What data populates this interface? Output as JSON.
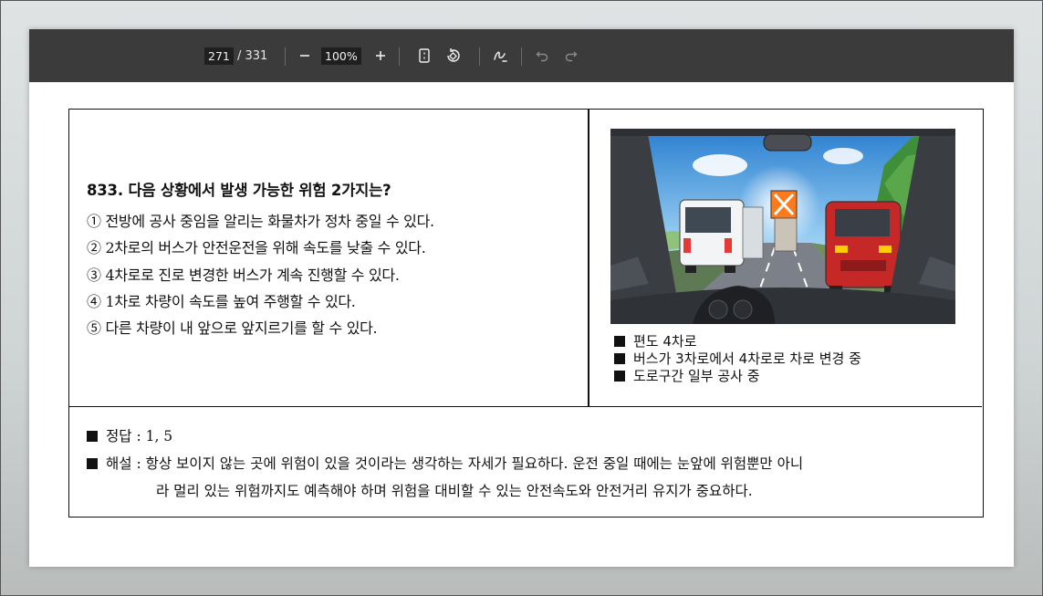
{
  "toolbar": {
    "page_current": "271",
    "page_total": "/ 331",
    "zoom": "100%",
    "icons": [
      "minus-icon",
      "plus-icon",
      "fit-page-icon",
      "rotate-icon",
      "draw-icon",
      "undo-icon",
      "redo-icon"
    ]
  },
  "question": {
    "title": "833. 다음 상황에서 발생 가능한 위험 2가지는?",
    "options": [
      "① 전방에 공사 중임을 알리는 화물차가 정차 중일 수 있다.",
      "② 2차로의 버스가 안전운전을 위해 속도를 낮출 수 있다.",
      "③ 4차로로 진로 변경한 버스가 계속 진행할 수 있다.",
      "④ 1차로 차량이 속도를 높여 주행할 수 있다.",
      "⑤ 다른 차량이 내 앞으로 앞지르기를 할 수 있다."
    ]
  },
  "situation": {
    "notes": [
      "편도 4차로",
      "버스가 3차로에서 4차로로 차로 변경 중",
      "도로구간 일부 공사 중"
    ]
  },
  "answer": {
    "label": "정답 : 1, 5",
    "explanation_line1": "해설 : 항상 보이지 않는 곳에 위험이 있을 것이라는 생각하는 자세가 필요하다. 운전 중일 때에는 눈앞에 위험뿐만 아니",
    "explanation_line2": "라 멀리 있는 위험까지도 예측해야 하며 위험을 대비할 수 있는 안전속도와 안전거리 유지가 중요하다."
  }
}
